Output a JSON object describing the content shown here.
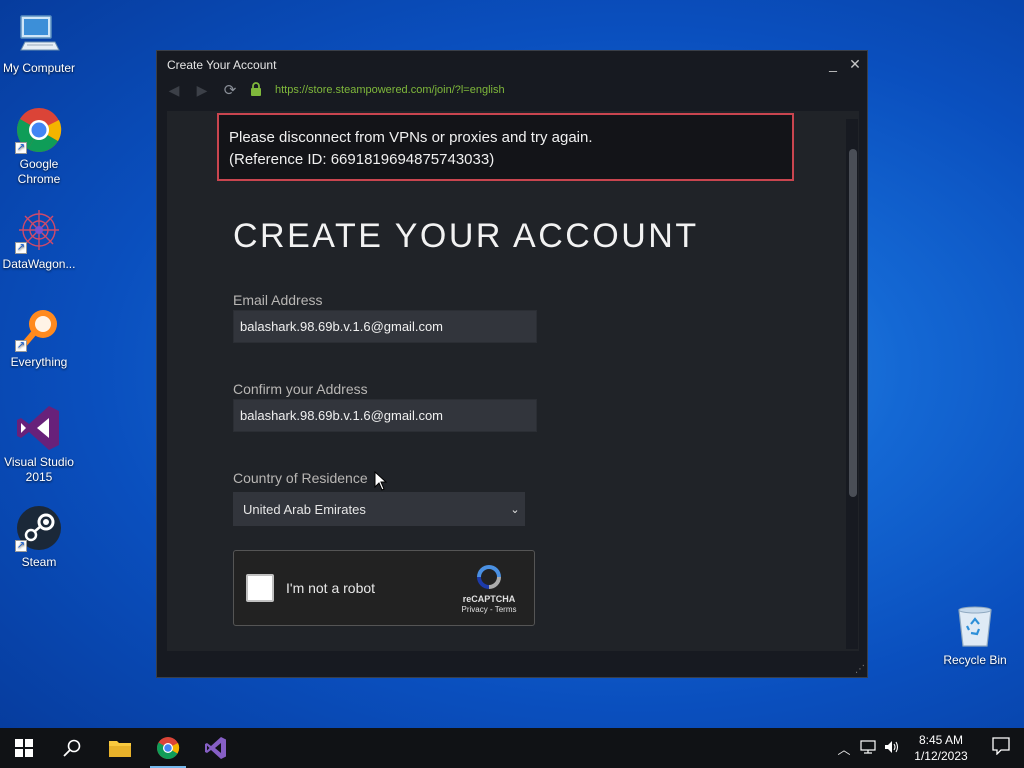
{
  "desktop": {
    "icons": [
      {
        "label": "My Computer",
        "icon": "computer-icon"
      },
      {
        "label": "Google Chrome",
        "icon": "chrome-icon"
      },
      {
        "label": "DataWagon...",
        "icon": "datawagon-icon"
      },
      {
        "label": "Everything",
        "icon": "everything-search-icon"
      },
      {
        "label": "Visual Studio 2015",
        "icon": "visual-studio-icon"
      },
      {
        "label": "Steam",
        "icon": "steam-icon"
      },
      {
        "label": "Recycle Bin",
        "icon": "recycle-bin-icon"
      }
    ]
  },
  "window": {
    "title": "Create Your Account",
    "minimize": "_",
    "close": "✕",
    "url": "https://store.steampowered.com/join/?l=english",
    "alert": {
      "line1": "Please disconnect from VPNs or proxies and try again.",
      "line2": "(Reference ID: 6691819694875743033)"
    },
    "heading": "CREATE YOUR ACCOUNT",
    "email": {
      "label": "Email Address",
      "value": "balashark.98.69b.v.1.6@gmail.com"
    },
    "confirm": {
      "label": "Confirm your Address",
      "value": "balashark.98.69b.v.1.6@gmail.com"
    },
    "country": {
      "label": "Country of Residence",
      "value": "United Arab Emirates"
    },
    "recaptcha": {
      "label": "I'm not a robot",
      "brand": "reCAPTCHA",
      "links": "Privacy - Terms"
    }
  },
  "taskbar": {
    "time": "8:45 AM",
    "date": "1/12/2023"
  },
  "colors": {
    "accent_green": "#7fb83b",
    "alert_border": "#c9454f",
    "window_bg": "#171a21",
    "content_bg": "#202328"
  }
}
